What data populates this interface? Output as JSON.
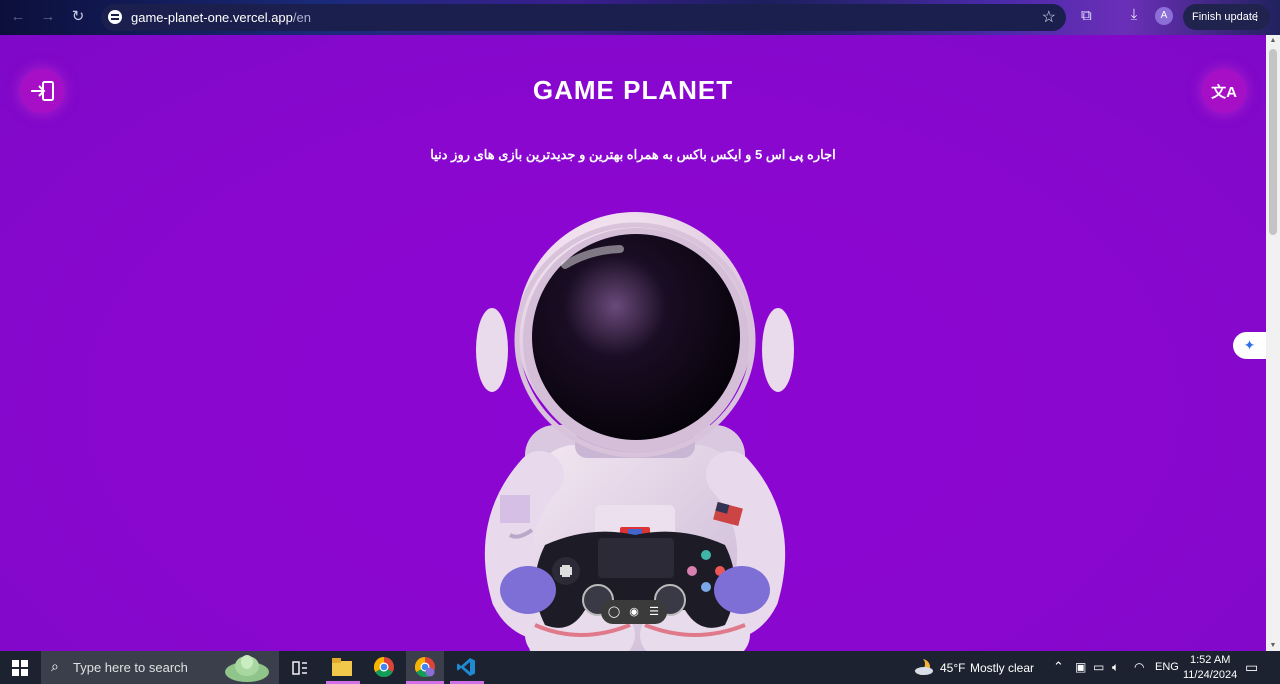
{
  "browser": {
    "back_icon": "←",
    "forward_icon": "→",
    "reload_icon": "↻",
    "url_host": "game-planet-one.vercel.app",
    "url_path": "/en",
    "bookmark_icon": "☆",
    "extensions_icon": "⧉",
    "download_icon": "⤓",
    "profile_initial": "A",
    "finish_update_label": "Finish update",
    "menu_icon": "⋮"
  },
  "page": {
    "login_icon": "⇥",
    "translate_icon": "文A",
    "title": "GAME PLANET",
    "subtitle": "اجاره پی اس 5 و ایکس باکس به همراه بهترین و جدیدترین بازی های روز دنیا",
    "side_tab_icon": "✦",
    "toolbar_icons": [
      "◯",
      "◉",
      "☰"
    ]
  },
  "taskbar": {
    "start_icon": "windows-logo",
    "search_placeholder": "Type here to search",
    "weather_temp": "45°F",
    "weather_text": "Mostly clear",
    "chevron_icon": "⌃",
    "language": "ENG",
    "time": "1:52 AM",
    "date": "11/24/2024",
    "notification_icon": "▭"
  },
  "colors": {
    "page_bg": "#8a07cf",
    "accent_button": "#a60fc6",
    "taskbar_bg": "#1c2230"
  }
}
